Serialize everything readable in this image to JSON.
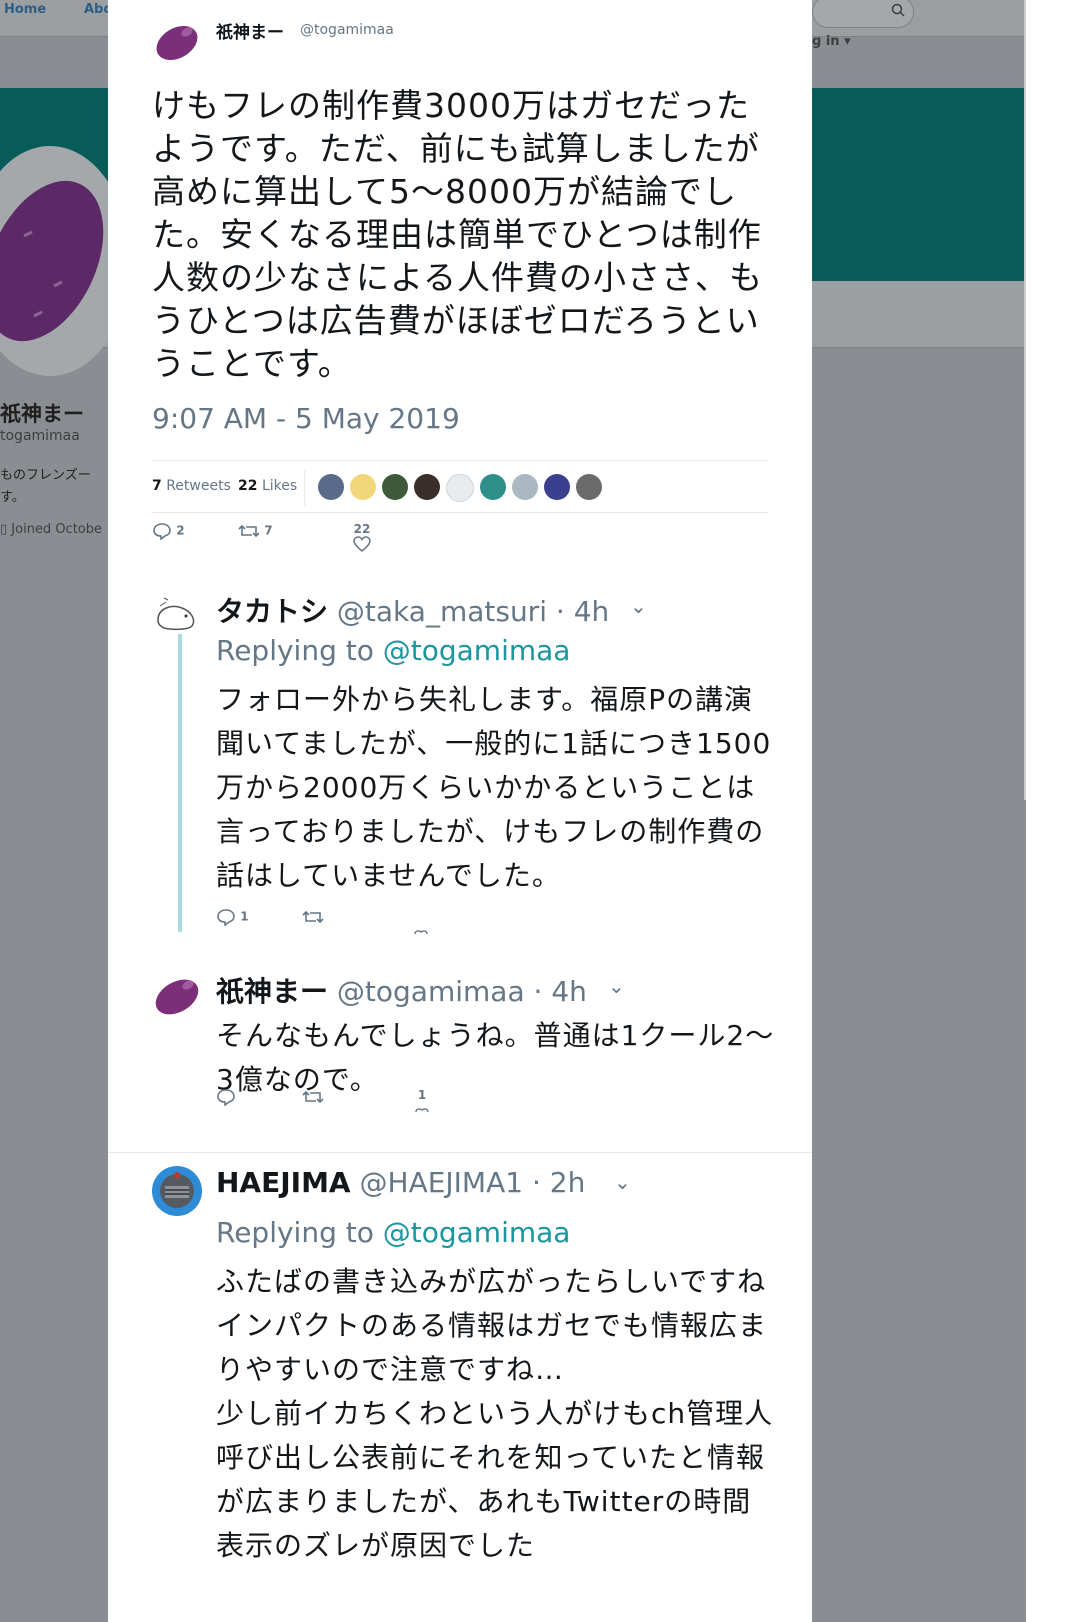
{
  "background": {
    "nav_home": "Home",
    "nav_about": "Abo",
    "login": "g in",
    "profile_name": "祇神まー",
    "profile_handle": "togamimaa",
    "bio_line1": "ものフレンズー",
    "bio_line2": "す。",
    "joined": "Joined Octobe",
    "banner_color": "#075c5a"
  },
  "main_tweet": {
    "author_name": "祇神まー",
    "author_handle": "@togamimaa",
    "text": "けもフレの制作費3000万はガセだったようです。ただ、前にも試算しましたが高めに算出して5〜8000万が結論でした。安くなる理由は簡単でひとつは制作人数の少なさによる人件費の小ささ、もうひとつは広告費がほぼゼロだろうということです。",
    "timestamp": "9:07 AM - 5 May 2019",
    "retweet_count": "7",
    "retweets_label": "Retweets",
    "like_count": "22",
    "likes_label": "Likes",
    "actions": {
      "reply": "2",
      "retweet": "7",
      "like": "22"
    }
  },
  "replies": [
    {
      "name": "タカトシ",
      "handle": "@taka_matsuri",
      "time": "· 4h",
      "replying_prefix": "Replying to",
      "replying_to": "@togamimaa",
      "text": "フォロー外から失礼します。福原Pの講演聞いてましたが、一般的に1話につき1500万から2000万くらいかかるということは言っておりましたが、けもフレの制作費の話はしていませんでした。",
      "actions": {
        "reply": "1",
        "retweet": "",
        "like": ""
      }
    },
    {
      "name": "祇神まー",
      "handle": "@togamimaa",
      "time": "· 4h",
      "text": "そんなもんでしょうね。普通は1クール2〜3億なので。",
      "actions": {
        "reply": "",
        "retweet": "",
        "like": "1"
      }
    },
    {
      "name": "HAEJIMA",
      "handle": "@HAEJIMA1",
      "time": "· 2h",
      "replying_prefix": "Replying to",
      "replying_to": "@togamimaa",
      "text_lines": [
        "ふたばの書き込みが広がったらしいですね",
        "インパクトのある情報はガセでも情報広まりやすいので注意ですね…",
        "少し前イカちくわという人がけもch管理人呼び出し公表前にそれを知っていたと情報が広まりましたが、あれもTwitterの時間表示のズレが原因でした"
      ]
    }
  ],
  "colors": {
    "link": "#1b95a0",
    "thread_line": "#a7dde0",
    "muted": "#657786"
  }
}
